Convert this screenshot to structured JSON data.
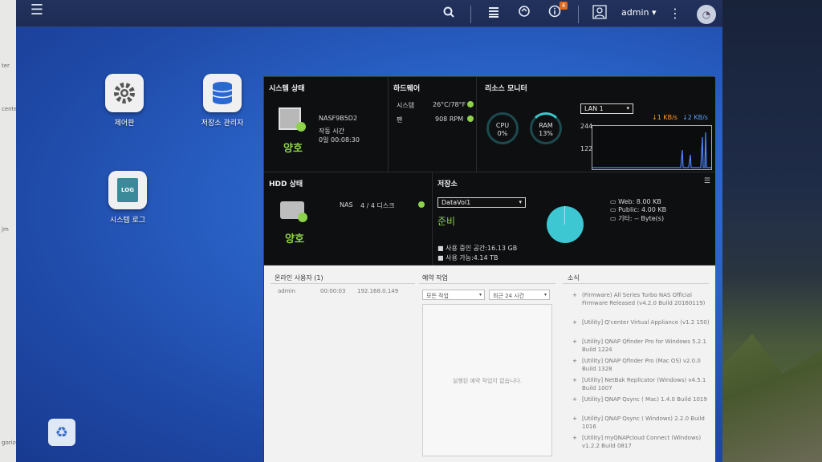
{
  "left_strip": [
    "ter",
    "cente",
    "jm",
    "gorized"
  ],
  "topbar": {
    "user": "admin",
    "notif_count": "4"
  },
  "desktop_icons": [
    {
      "label": "제어판"
    },
    {
      "label": "저장소 관리자"
    },
    {
      "label": "시스템 로그",
      "tile_text": "LOG"
    }
  ],
  "system_status": {
    "title": "시스템 상태",
    "hostname": "NASF9B5D2",
    "uptime_label": "작동 시간",
    "uptime": "0일 00:08:30",
    "status": "양호"
  },
  "hardware": {
    "title": "하드웨어",
    "rows": [
      {
        "label": "시스템",
        "value": "26°C/78°F"
      },
      {
        "label": "팬",
        "value": "908 RPM"
      }
    ]
  },
  "resource_monitor": {
    "title": "리소스 모니터",
    "cpu_label": "CPU",
    "cpu_value": "0%",
    "ram_label": "RAM",
    "ram_value": "13%",
    "lan_select": "LAN 1",
    "down_rate": "↓1 KB/s",
    "up_rate": "↓2 KB/s",
    "y_max": "244",
    "y_mid": "122"
  },
  "hdd_status": {
    "title": "HDD 상태",
    "nas_label": "NAS",
    "disks": "4 / 4 디스크",
    "status": "양호"
  },
  "storage": {
    "title": "저장소",
    "volume": "DataVol1",
    "state": "준비",
    "used": "사용 중인 공간:16.13 GB",
    "free": "사용 가능:4.14 TB",
    "legend": [
      "Web: 8.00 KB",
      "Public: 4.00 KB",
      "기타: -- Byte(s)"
    ]
  },
  "online_users": {
    "title": "온라인 사용자 (1)",
    "rows": [
      {
        "user": "admin",
        "time": "00:00:03",
        "ip": "192.168.0.149"
      }
    ]
  },
  "scheduled": {
    "title": "예약 작업",
    "filter1": "모든 작업",
    "filter2": "최근 24 시간",
    "empty": "실행된 예약 작업이 없습니다."
  },
  "news": {
    "title": "소식",
    "items": [
      "(Firmware) All Series Turbo NAS Official Firmware Released (v4.2.0 Build 20160119)",
      "[Utility] Q'center Virtual Appliance (v1.2 150)",
      "[Utility] QNAP Qfinder Pro for Windows 5.2.1 Build 1224",
      "[Utility] QNAP Qfinder Pro (Mac OS) v2.0.0 Build 1328",
      "[Utility] NetBak Replicator (Windows) v4.5.1 Build 1007",
      "[Utility] QNAP Qsync ( Mac) 1.4.0 Build 1019",
      "[Utility] QNAP Qsync ( Windows) 2.2.0 Build 1016",
      "[Utility] myQNAPcloud Connect (Windows) v1.2.2 Build 0817"
    ]
  }
}
